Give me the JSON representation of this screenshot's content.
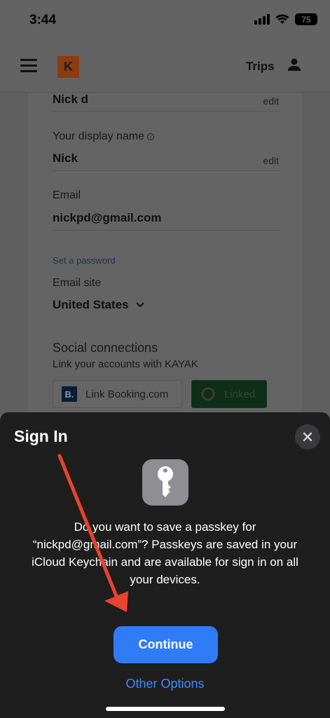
{
  "status_bar": {
    "time": "3:44",
    "battery": "75"
  },
  "header": {
    "logo_letter": "K",
    "trips_label": "Trips"
  },
  "profile": {
    "name_value": "Nick d",
    "name_edit": "edit",
    "display_name_label": "Your display name",
    "display_name_value": "Nick",
    "display_name_edit": "edit",
    "email_label": "Email",
    "email_value": "nickpd@gmail.com",
    "set_password_link": "Set a password",
    "email_site_label": "Email site",
    "email_site_value": "United States",
    "social_title": "Social connections",
    "social_subtitle": "Link your accounts with KAYAK",
    "booking_button": "Link Booking.com",
    "booking_logo": "B.",
    "google_button": "Linked"
  },
  "sheet": {
    "title": "Sign In",
    "message": "Do you want to save a passkey for “nickpd@gmail.com”? Passkeys are saved in your iCloud Keychain and are available for sign in on all your devices.",
    "continue_label": "Continue",
    "other_options_label": "Other Options"
  },
  "colors": {
    "continue_blue": "#2f7cf6",
    "link_blue": "#3d8bff",
    "sheet_bg": "#1e1e1e",
    "annotation_red": "#e8432f"
  }
}
